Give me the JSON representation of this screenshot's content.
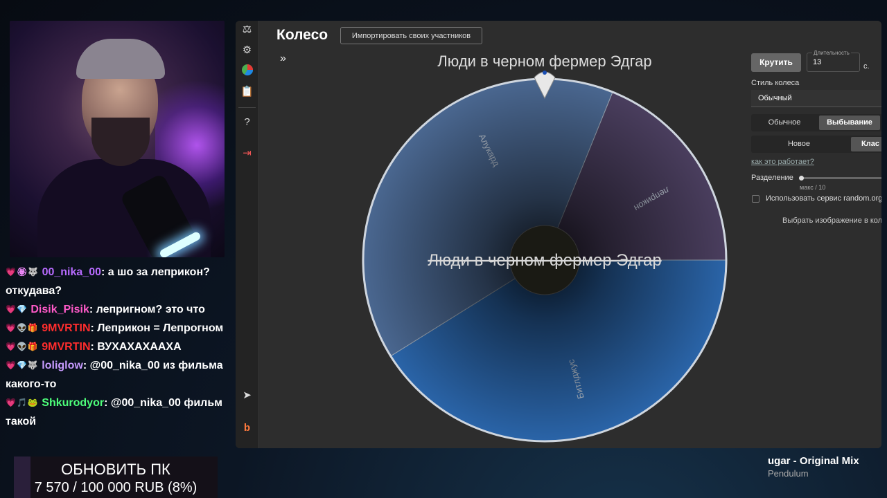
{
  "chat": [
    {
      "badges": "💗🏵🐺",
      "user": "00_nika_00",
      "color": "#b86bff",
      "text": "а шо за леприкон? откудава?"
    },
    {
      "badges": "💗💎",
      "user": "Disik_Pisik",
      "color": "#ff5ac8",
      "text": "лепригном? это что"
    },
    {
      "badges": "💗👽🎁",
      "user": "9MVRTIN",
      "color": "#ff2d2d",
      "text": "Леприкон = Лепрогном"
    },
    {
      "badges": "💗👽🎁",
      "user": "9MVRTIN",
      "color": "#ff2d2d",
      "text": "ВУХАХАХААХА"
    },
    {
      "badges": "💗💎🐺",
      "user": "loliglow",
      "color": "#c79bff",
      "text": "@00_nika_00 из фильма какого-то"
    },
    {
      "badges": "💗🎵🐸",
      "user": "Shkurodyor",
      "color": "#4dff7a",
      "text": "@00_nika_00 фильм такой"
    }
  ],
  "donation": {
    "title": "ОБНОВИТЬ ПК",
    "amount_text": "7 570 / 100 000 RUB (8%)",
    "progress": 0.08
  },
  "app": {
    "title": "Колесо",
    "import_button": "Импортировать своих участников",
    "expand_icon": "»",
    "winner_top": "Люди в черном фермер Эдгар",
    "winner_center": "Люди в черном фермер Эдгар",
    "wheel": {
      "segments": [
        {
          "label": "Алукард",
          "color": "#4a6790"
        },
        {
          "label": "леприкон",
          "color": "#4a3e5e"
        },
        {
          "label": "Битлджус",
          "color": "#2a64a8"
        }
      ]
    },
    "controls": {
      "spin_button": "Крутить",
      "duration_label": "Длительность",
      "duration_value": "13",
      "duration_unit": "с.",
      "wheel_style_label": "Стиль колеса",
      "wheel_style_value": "Обычный",
      "mode_options": [
        "Обычное",
        "Выбывание"
      ],
      "mode_selected": "Выбывание",
      "variant_options": [
        "Новое",
        "Клас"
      ],
      "variant_selected": "Клас",
      "how_link": "как это работает?",
      "split_label": "Разделение",
      "split_max": "макс / 10",
      "random_org_label": "Использовать сервис random.org",
      "choose_image": "Выбрать изображение в кол"
    }
  },
  "now_playing": {
    "song": "ugar - Original Mix",
    "artist": "Pendulum"
  }
}
